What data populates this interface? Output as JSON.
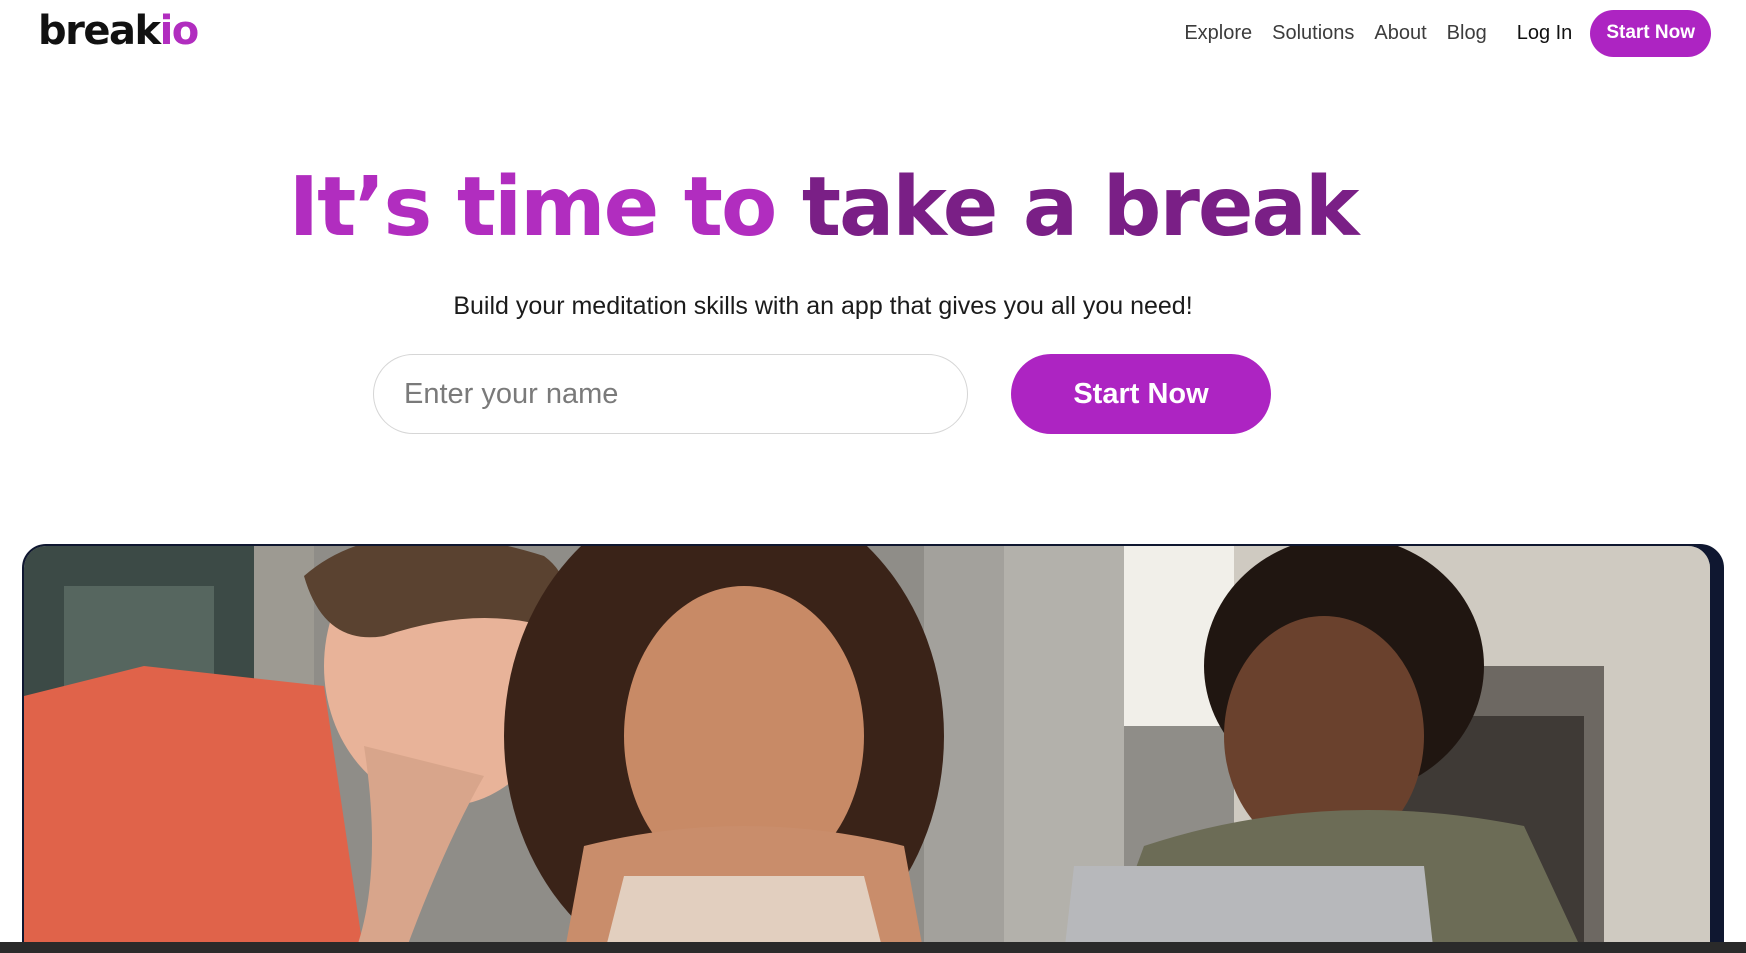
{
  "brand": {
    "part1": "break",
    "part2": "io",
    "accent": "#b12dbf"
  },
  "nav": {
    "items": [
      "Explore",
      "Solutions",
      "About",
      "Blog"
    ],
    "login": "Log In",
    "cta": "Start Now"
  },
  "hero": {
    "title_part1": "It’s time to",
    "title_part2": " take a break",
    "subtitle": "Build your meditation skills with an app that gives you all you need!",
    "input_placeholder": "Enter your name",
    "cta": "Start Now",
    "title_color_1": "#b12dbf",
    "title_color_2": "#7a1f86"
  },
  "photo": {
    "description_icon": "people-photo"
  }
}
